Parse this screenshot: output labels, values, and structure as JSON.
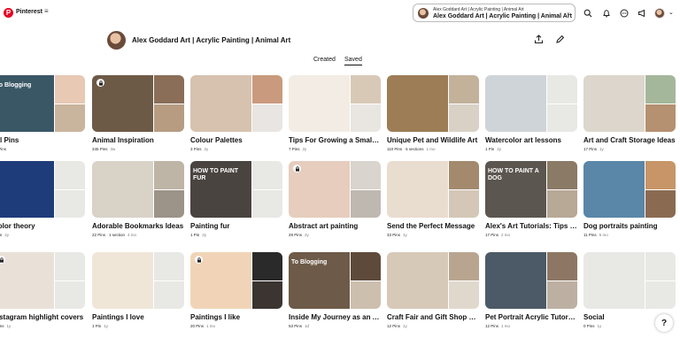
{
  "header": {
    "brand": "Pinterest",
    "brand_menu": "≡",
    "account_line1": "Alex Goddard Art | Acrylic Painting | Animal Art",
    "account_line2": "Alex Goddard Art | Acrylic Painting | Animal Art",
    "icons": [
      "search-icon",
      "notifications-icon",
      "messages-icon",
      "updates-icon",
      "avatar"
    ]
  },
  "profile": {
    "name": "Alex Goddard Art | Acrylic Painting | Animal Art"
  },
  "tabs": [
    {
      "label": "Created"
    },
    {
      "label": "Saved"
    }
  ],
  "boards": [
    {
      "title": "All Pins",
      "pins": "17 Pins",
      "time": "",
      "secret": false,
      "colors": [
        "#3a5766",
        "#e7c9b4",
        "#c9b49d"
      ],
      "cover_text": "To Blogging"
    },
    {
      "title": "Animal Inspiration",
      "pins": "345 Pins",
      "time": "3w",
      "secret": true,
      "colors": [
        "#6d5a46",
        "#8a6e57",
        "#b79c82"
      ],
      "cover_text": ""
    },
    {
      "title": "Colour Palettes",
      "pins": "3 Pins",
      "time": "2y",
      "secret": false,
      "colors": [
        "#d7c2b0",
        "#c99a7d",
        "#e8e5e2"
      ],
      "cover_text": ""
    },
    {
      "title": "Tips For Growing a Small Business",
      "pins": "7 Pins",
      "time": "2y",
      "secret": false,
      "colors": [
        "#f2ece4",
        "#d8c9b7",
        "#e9e6e2"
      ],
      "cover_text": ""
    },
    {
      "title": "Unique Pet and Wildlife Art",
      "pins": "110 Pins · 5 sections",
      "time": "1 mo",
      "secret": false,
      "colors": [
        "#9c7d56",
        "#c3b19a",
        "#d9d1c6"
      ],
      "cover_text": ""
    },
    {
      "title": "Watercolor art lessons",
      "pins": "1 Pin",
      "time": "2y",
      "secret": false,
      "colors": [
        "#cfd4d8",
        "#e8e8e5",
        "#e8e8e5"
      ],
      "cover_text": ""
    },
    {
      "title": "Art and Craft Storage Ideas",
      "pins": "17 Pins",
      "time": "1y",
      "secret": false,
      "colors": [
        "#dcd6cd",
        "#a5b79b",
        "#b59071"
      ],
      "cover_text": ""
    },
    {
      "title": "Color theory",
      "pins": "1 Pin",
      "time": "2y",
      "secret": false,
      "colors": [
        "#1f3c7a",
        "#e8e8e5",
        "#e8e8e5"
      ],
      "cover_text": ""
    },
    {
      "title": "Adorable Bookmarks Ideas",
      "pins": "22 Pins · 1 section",
      "time": "4 mo",
      "secret": false,
      "colors": [
        "#d9d2c7",
        "#bfb5a6",
        "#9c9389"
      ],
      "cover_text": ""
    },
    {
      "title": "Painting fur",
      "pins": "1 Pin",
      "time": "2y",
      "secret": false,
      "colors": [
        "#4a4440",
        "#e8e8e5",
        "#e8e8e5"
      ],
      "cover_text": "HOW TO PAINT FUR"
    },
    {
      "title": "Abstract art painting",
      "pins": "29 Pins",
      "time": "2y",
      "secret": true,
      "colors": [
        "#e6cdbd",
        "#d9d4ce",
        "#bfb8b0"
      ],
      "cover_text": ""
    },
    {
      "title": "Send the Perfect Message",
      "pins": "33 Pins",
      "time": "1y",
      "secret": false,
      "colors": [
        "#e9ddd0",
        "#a38a6d",
        "#d4c7b7"
      ],
      "cover_text": ""
    },
    {
      "title": "Alex's Art Tutorials: Tips and Techniques",
      "pins": "17 Pins",
      "time": "2 mo",
      "secret": false,
      "colors": [
        "#5c5650",
        "#8b7a66",
        "#b8a896"
      ],
      "cover_text": "HOW TO PAINT A DOG"
    },
    {
      "title": "Dog portraits painting",
      "pins": "11 Pins",
      "time": "5 mo",
      "secret": false,
      "colors": [
        "#5a86a8",
        "#c79567",
        "#8a6b52"
      ],
      "cover_text": ""
    },
    {
      "title": "Instagram highlight covers",
      "pins": "2 Pins",
      "time": "1y",
      "secret": true,
      "colors": [
        "#e9e1d8",
        "#e8e8e5",
        "#e8e8e5"
      ],
      "cover_text": ""
    },
    {
      "title": "Paintings I love",
      "pins": "1 Pin",
      "time": "1y",
      "secret": false,
      "colors": [
        "#f0e6d8",
        "#e8e8e5",
        "#e8e8e5"
      ],
      "cover_text": ""
    },
    {
      "title": "Paintings I like",
      "pins": "20 Pins",
      "time": "1 mo",
      "secret": true,
      "colors": [
        "#f1d4b7",
        "#2a2a2a",
        "#3b3430"
      ],
      "cover_text": ""
    },
    {
      "title": "Inside My Journey as an Artist",
      "pins": "53 Pins",
      "time": "1d",
      "secret": false,
      "colors": [
        "#6d5a48",
        "#5e4a3b",
        "#cdbfae"
      ],
      "cover_text": "To Blogging"
    },
    {
      "title": "Craft Fair and Gift Shop Display Ideas",
      "pins": "12 Pins",
      "time": "1y",
      "secret": false,
      "colors": [
        "#d7c9b8",
        "#b9a58f",
        "#e1d8cd"
      ],
      "cover_text": ""
    },
    {
      "title": "Pet Portrait Acrylic Tutorials",
      "pins": "12 Pins",
      "time": "1 mo",
      "secret": false,
      "colors": [
        "#4b5a66",
        "#8d7764",
        "#bdb0a2"
      ],
      "cover_text": ""
    },
    {
      "title": "Social",
      "pins": "0 Pins",
      "time": "1y",
      "secret": false,
      "colors": [
        "#e8e8e5",
        "#e8e8e5",
        "#e8e8e5"
      ],
      "cover_text": ""
    }
  ],
  "help": "?"
}
